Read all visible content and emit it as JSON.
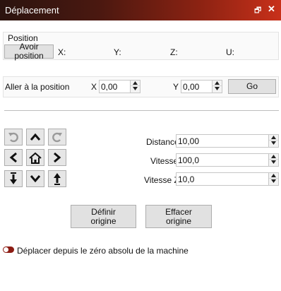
{
  "window": {
    "title": "Déplacement",
    "float_icon": "float-window-icon",
    "close_icon": "close-icon",
    "colors": {
      "title_dark": "#2b140f",
      "title_accent": "#c8301a",
      "toggle": "#8c1c13"
    }
  },
  "position": {
    "group_label": "Position",
    "button_label": "Avoir position",
    "labels": [
      "X:",
      "Y:",
      "Z:",
      "U:"
    ]
  },
  "goto": {
    "label": "Aller à la position",
    "x_label": "X",
    "x_value": "0,00",
    "y_label": "Y",
    "y_value": "0,00",
    "go_label": "Go"
  },
  "jog": {
    "buttons": [
      "rotate-ccw-icon",
      "arrow-up-icon",
      "rotate-cw-icon",
      "arrow-left-icon",
      "home-icon",
      "arrow-right-icon",
      "z-down-icon",
      "arrow-down-icon",
      "z-up-icon"
    ]
  },
  "params": {
    "distance_label": "Distance",
    "distance_value": "10,00",
    "vitesse_label": "Vitesse",
    "vitesse_value": "100,0",
    "vitesse_z_label": "Vitesse Z",
    "vitesse_z_value": "10,0"
  },
  "actions": {
    "set_origin_line1": "Définir",
    "set_origin_line2": "origine",
    "clear_origin_line1": "Effacer",
    "clear_origin_line2": "origine"
  },
  "option": {
    "toggle_label": "Déplacer depuis le zéro absolu de la machine",
    "toggle_on": true
  }
}
